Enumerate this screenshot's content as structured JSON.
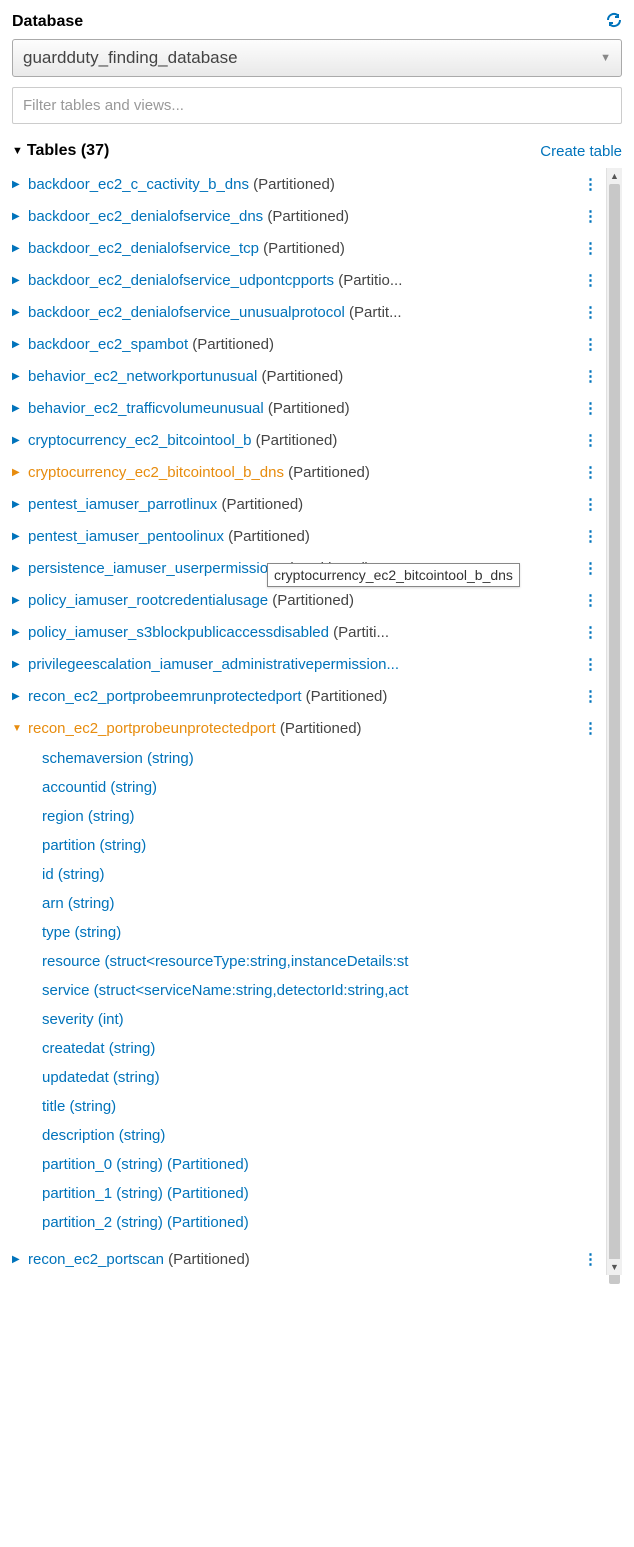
{
  "header": {
    "title": "Database"
  },
  "db_select": {
    "value": "guardduty_finding_database"
  },
  "filter": {
    "placeholder": "Filter tables and views..."
  },
  "tables_section": {
    "label_prefix": "Tables",
    "count": "(37)",
    "create_label": "Create table"
  },
  "suffix_partitioned": "(Partitioned)",
  "suffix_truncated_partitio": "(Partitio...",
  "suffix_truncated_partit": "(Partit...",
  "suffix_truncated_partiti": "(Partiti...",
  "tables": [
    {
      "name": "backdoor_ec2_c_cactivity_b_dns",
      "suffix": "(Partitioned)",
      "truncate": false
    },
    {
      "name": "backdoor_ec2_denialofservice_dns",
      "suffix": "(Partitioned)",
      "truncate": false
    },
    {
      "name": "backdoor_ec2_denialofservice_tcp",
      "suffix": "(Partitioned)",
      "truncate": false
    },
    {
      "name": "backdoor_ec2_denialofservice_udpontcpports",
      "suffix": "(Partitio...",
      "truncate": true
    },
    {
      "name": "backdoor_ec2_denialofservice_unusualprotocol",
      "suffix": "(Partit...",
      "truncate": true
    },
    {
      "name": "backdoor_ec2_spambot",
      "suffix": "(Partitioned)",
      "truncate": false
    },
    {
      "name": "behavior_ec2_networkportunusual",
      "suffix": "(Partitioned)",
      "truncate": false
    },
    {
      "name": "behavior_ec2_trafficvolumeunusual",
      "suffix": "(Partitioned)",
      "truncate": false
    },
    {
      "name": "cryptocurrency_ec2_bitcointool_b",
      "suffix": "(Partitioned)",
      "truncate": false
    },
    {
      "name": "cryptocurrency_ec2_bitcointool_b_dns",
      "suffix": "(Partitioned)",
      "truncate": false,
      "hover": true
    },
    {
      "name": "pentest_iamuser_parrotlinux",
      "suffix": "(Partitioned)",
      "truncate": false
    },
    {
      "name": "pentest_iamuser_pentoolinux",
      "suffix": "(Partitioned)",
      "truncate": false
    },
    {
      "name": "persistence_iamuser_userpermissions",
      "suffix": "(Partitioned)",
      "truncate": false
    },
    {
      "name": "policy_iamuser_rootcredentialusage",
      "suffix": "(Partitioned)",
      "truncate": false
    },
    {
      "name": "policy_iamuser_s3blockpublicaccessdisabled",
      "suffix": "(Partiti...",
      "truncate": true
    },
    {
      "name": "privilegeescalation_iamuser_administrativepermission...",
      "suffix": "",
      "truncate": true
    },
    {
      "name": "recon_ec2_portprobeemrunprotectedport",
      "suffix": "(Partitioned)",
      "truncate": false
    },
    {
      "name": "recon_ec2_portprobeunprotectedport",
      "suffix": "(Partitioned)",
      "truncate": false,
      "expanded": true
    },
    {
      "name": "recon_ec2_portscan",
      "suffix": "(Partitioned)",
      "truncate": false
    }
  ],
  "expanded_columns": [
    "schemaversion (string)",
    "accountid (string)",
    "region (string)",
    "partition (string)",
    "id (string)",
    "arn (string)",
    "type (string)",
    "resource (struct<resourceType:string,instanceDetails:st",
    "service (struct<serviceName:string,detectorId:string,act",
    "severity (int)",
    "createdat (string)",
    "updatedat (string)",
    "title (string)",
    "description (string)",
    "partition_0 (string) (Partitioned)",
    "partition_1 (string) (Partitioned)",
    "partition_2 (string) (Partitioned)"
  ],
  "tooltip": {
    "text": "cryptocurrency_ec2_bitcointool_b_dns"
  }
}
